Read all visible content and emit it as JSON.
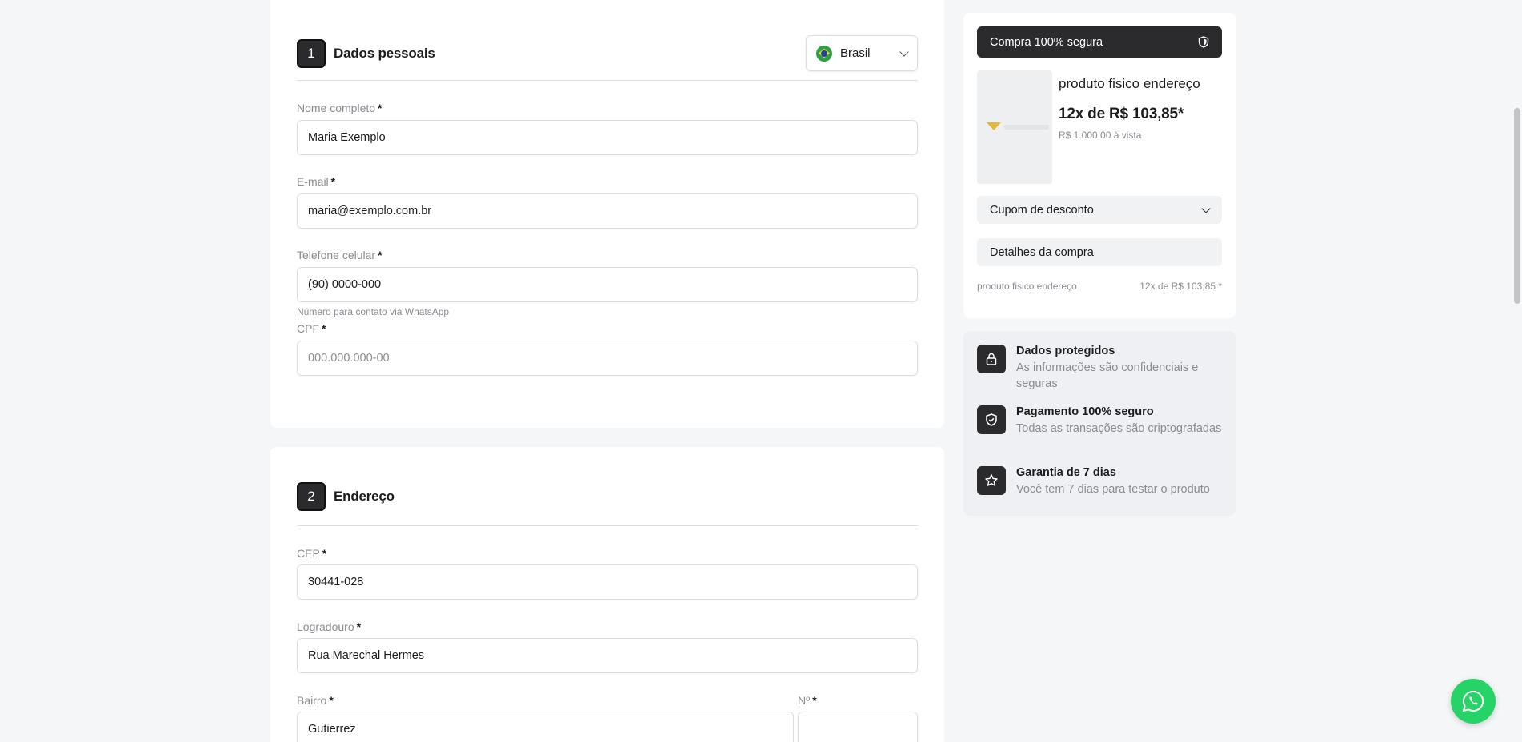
{
  "personal": {
    "step": "1",
    "title": "Dados pessoais",
    "country": {
      "label": "Brasil",
      "icon": "brazil-flag-icon"
    },
    "fields": {
      "name": {
        "label": "Nome completo",
        "value": "Maria Exemplo"
      },
      "email": {
        "label": "E-mail",
        "value": "maria@exemplo.com.br"
      },
      "phone": {
        "label": "Telefone celular",
        "value": "(90) 0000-000",
        "hint": "Número para contato via WhatsApp"
      },
      "cpf": {
        "label": "CPF",
        "placeholder": "000.000.000-00"
      }
    },
    "required_mark": "*"
  },
  "address": {
    "step": "2",
    "title": "Endereço",
    "fields": {
      "cep": {
        "label": "CEP",
        "value": "30441-028"
      },
      "street": {
        "label": "Logradouro",
        "value": "Rua Marechal Hermes"
      },
      "district": {
        "label": "Bairro",
        "value": "Gutierrez"
      },
      "number": {
        "label": "Nº",
        "value": ""
      }
    }
  },
  "summary": {
    "secure_label": "Compra 100% segura",
    "product": {
      "name": "produto fisico endereço",
      "installments": "12x de R$ 103,85",
      "installments_mark": "*",
      "cash": "R$ 1.000,00 à vista"
    },
    "coupon_label": "Cupom de desconto",
    "details_label": "Detalhes da compra",
    "line_item": {
      "name": "produto fisico endereço",
      "price": "12x de R$ 103,85 *"
    }
  },
  "trust": [
    {
      "title": "Dados protegidos",
      "desc": "As informações são confidenciais e seguras",
      "icon": "lock-icon"
    },
    {
      "title": "Pagamento 100% seguro",
      "desc": "Todas as transações são criptografadas",
      "icon": "shield-check-icon"
    },
    {
      "title": "Garantia de 7 dias",
      "desc": "Você tem 7 dias para testar o produto",
      "icon": "star-icon"
    }
  ],
  "colors": {
    "dark": "#2b2b2e",
    "whatsapp": "#25d366",
    "muted": "#8a8c92",
    "background": "#f5f6f8"
  }
}
